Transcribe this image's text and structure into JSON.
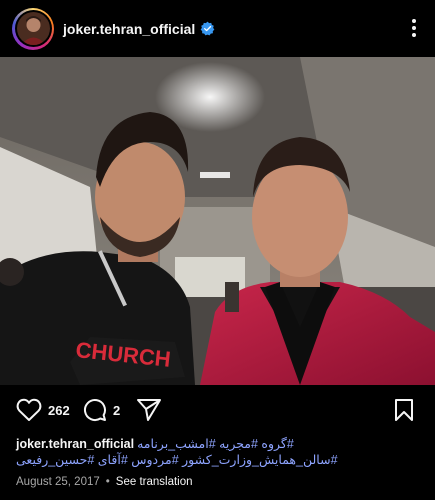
{
  "post": {
    "username": "joker.tehran_official",
    "verified": true,
    "likes": "262",
    "comments": "2",
    "caption_tags": "#گروه #مجریه #امشب_برنامه #سالن_همایش_وزارت_کشور #مردوس #آقای #حسین_رفیعی",
    "date": "August 25, 2017",
    "translate_label": "See translation"
  },
  "icons": {
    "more": "more-vertical-icon",
    "like": "heart-icon",
    "comment": "comment-icon",
    "share": "send-icon",
    "save": "bookmark-icon",
    "verified": "verified-badge-icon"
  },
  "colors": {
    "background": "#000000",
    "text": "#f5f5f5",
    "hashtag": "#8ea4ff",
    "verified": "#3897f0",
    "muted": "#a8a8a8"
  }
}
